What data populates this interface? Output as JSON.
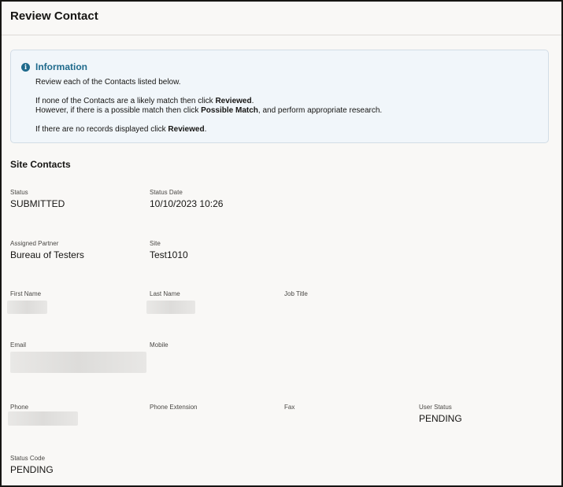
{
  "header": {
    "title": "Review Contact"
  },
  "info": {
    "title": "Information",
    "line1": "Review each of the Contacts listed below.",
    "line2_pre": "If none of the Contacts are a likely match then click ",
    "line2_bold": "Reviewed",
    "line2_post": ".",
    "line3_pre": "However, if there is a possible match then click ",
    "line3_bold": "Possible Match",
    "line3_post": ", and perform appropriate research.",
    "line4_pre": "If there are no records displayed click ",
    "line4_bold": "Reviewed",
    "line4_post": "."
  },
  "section": {
    "title": "Site Contacts"
  },
  "fields": {
    "status": {
      "label": "Status",
      "value": "SUBMITTED"
    },
    "status_date": {
      "label": "Status Date",
      "value": "10/10/2023 10:26"
    },
    "assigned_partner": {
      "label": "Assigned Partner",
      "value": "Bureau of Testers"
    },
    "site": {
      "label": "Site",
      "value": "Test1010"
    },
    "first_name": {
      "label": "First Name"
    },
    "last_name": {
      "label": "Last Name"
    },
    "job_title": {
      "label": "Job Title"
    },
    "email": {
      "label": "Email"
    },
    "mobile": {
      "label": "Mobile"
    },
    "phone": {
      "label": "Phone"
    },
    "phone_extension": {
      "label": "Phone Extension"
    },
    "fax": {
      "label": "Fax"
    },
    "user_status": {
      "label": "User Status",
      "value": "PENDING"
    },
    "status_code": {
      "label": "Status Code",
      "value": "PENDING"
    }
  },
  "colors": {
    "accent": "#1f6a8c",
    "background": "#f9f8f6",
    "info_bg": "#f1f6fa"
  }
}
